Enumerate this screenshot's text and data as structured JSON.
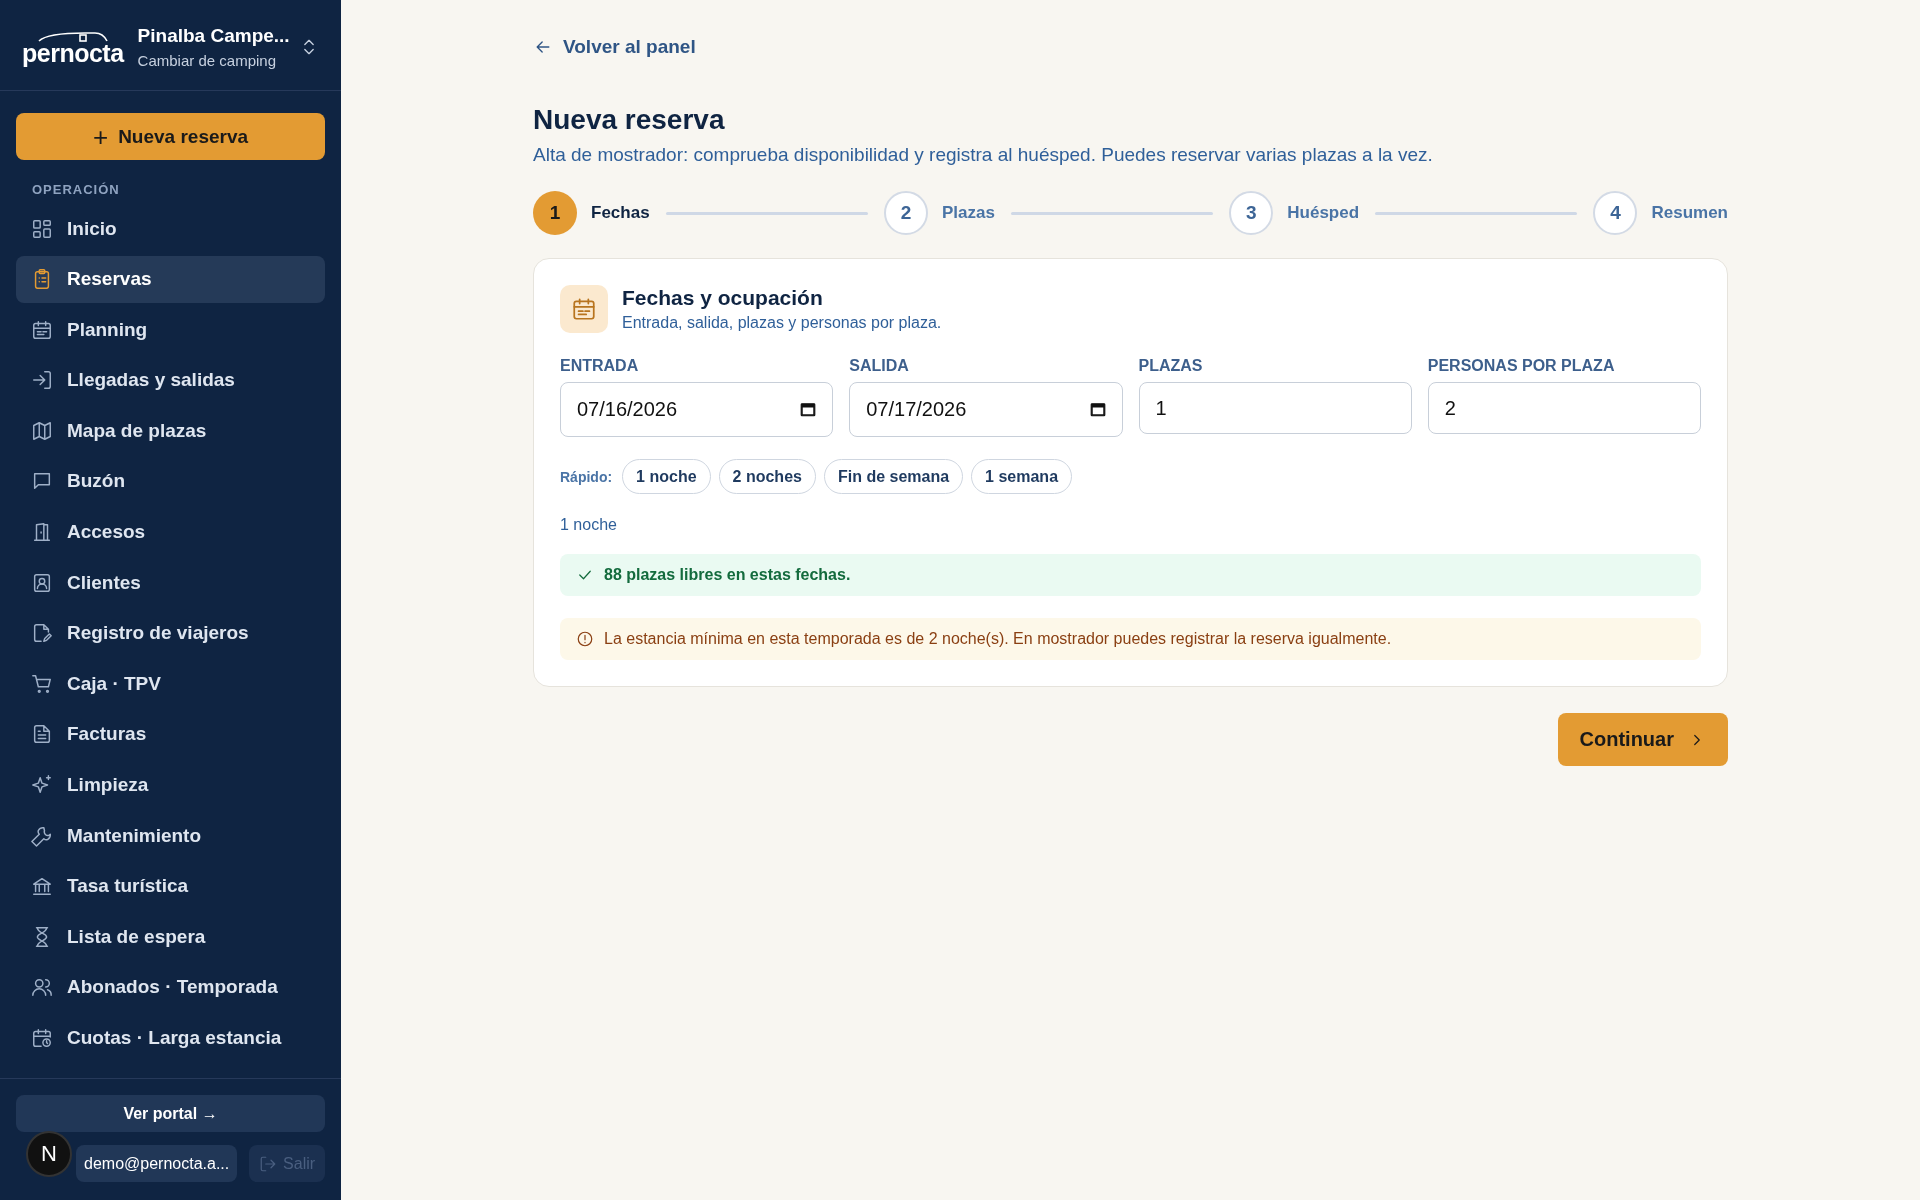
{
  "sidebar": {
    "brand": "pernocta",
    "campsite": {
      "name": "Pinalba Campe...",
      "subtitle": "Cambiar de camping"
    },
    "new_button": {
      "icon_text": "+",
      "label": "Nueva reserva"
    },
    "section": "OPERACIÓN",
    "items": [
      {
        "label": "Inicio",
        "selected": false
      },
      {
        "label": "Reservas",
        "selected": true
      },
      {
        "label": "Planning",
        "selected": false
      },
      {
        "label": "Llegadas y salidas",
        "selected": false
      },
      {
        "label": "Mapa de plazas",
        "selected": false
      },
      {
        "label": "Buzón",
        "selected": false
      },
      {
        "label": "Accesos",
        "selected": false
      },
      {
        "label": "Clientes",
        "selected": false
      },
      {
        "label": "Registro de viajeros",
        "selected": false
      },
      {
        "label": "Caja · TPV",
        "selected": false
      },
      {
        "label": "Facturas",
        "selected": false
      },
      {
        "label": "Limpieza",
        "selected": false
      },
      {
        "label": "Mantenimiento",
        "selected": false
      },
      {
        "label": "Tasa turística",
        "selected": false
      },
      {
        "label": "Lista de espera",
        "selected": false
      },
      {
        "label": "Abonados · Temporada",
        "selected": false
      },
      {
        "label": "Cuotas · Larga estancia",
        "selected": false
      }
    ],
    "portal_button": "Ver portal →",
    "user": "demo@pernocta.a...",
    "logout": {
      "label": "Salir",
      "disabled": true
    },
    "dev_badge": "N"
  },
  "main": {
    "back_link": "Volver al panel",
    "title": "Nueva reserva",
    "subtitle": "Alta de mostrador: comprueba disponibilidad y registra al huésped. Puedes reservar varias plazas a la vez.",
    "steps": [
      {
        "number": "1",
        "label": "Fechas",
        "selected": true
      },
      {
        "number": "2",
        "label": "Plazas",
        "selected": false
      },
      {
        "number": "3",
        "label": "Huésped",
        "selected": false
      },
      {
        "number": "4",
        "label": "Resumen",
        "selected": false
      }
    ],
    "card": {
      "title": "Fechas y ocupación",
      "subtitle": "Entrada, salida, plazas y personas por plaza.",
      "fields": [
        {
          "kind": "date",
          "label": "ENTRADA",
          "value": "07/16/2026"
        },
        {
          "kind": "date",
          "label": "SALIDA",
          "value": "07/17/2026"
        },
        {
          "kind": "number",
          "label": "PLAZAS",
          "value": "1"
        },
        {
          "kind": "number",
          "label": "PERSONAS POR PLAZA",
          "value": "2"
        }
      ],
      "quick_label": "Rápido:",
      "quick_options": [
        "1 noche",
        "2 noches",
        "Fin de semana",
        "1 semana"
      ],
      "nights": "1 noche",
      "alerts": [
        {
          "kind": "success",
          "text": "88 plazas libres en estas fechas."
        },
        {
          "kind": "warning",
          "text": "La estancia mínima en esta temporada es de 2 noche(s). En mostrador puedes registrar la reserva igualmente."
        }
      ]
    },
    "continue_button": "Continuar"
  }
}
